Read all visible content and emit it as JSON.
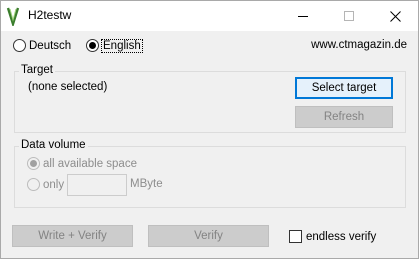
{
  "window": {
    "title": "H2testw",
    "icon": "h2testw-app-icon"
  },
  "language": {
    "options": [
      {
        "label": "Deutsch",
        "selected": false
      },
      {
        "label": "English",
        "selected": true
      }
    ]
  },
  "website": "www.ctmagazin.de",
  "target": {
    "group_label": "Target",
    "status": "(none selected)",
    "select_button": "Select target",
    "refresh_button": "Refresh"
  },
  "data_volume": {
    "group_label": "Data volume",
    "all_space_label": "all available space",
    "only_label": "only",
    "only_value": "",
    "unit": "MByte"
  },
  "actions": {
    "write_verify": "Write + Verify",
    "verify": "Verify",
    "endless_verify": "endless verify",
    "endless_checked": false
  }
}
